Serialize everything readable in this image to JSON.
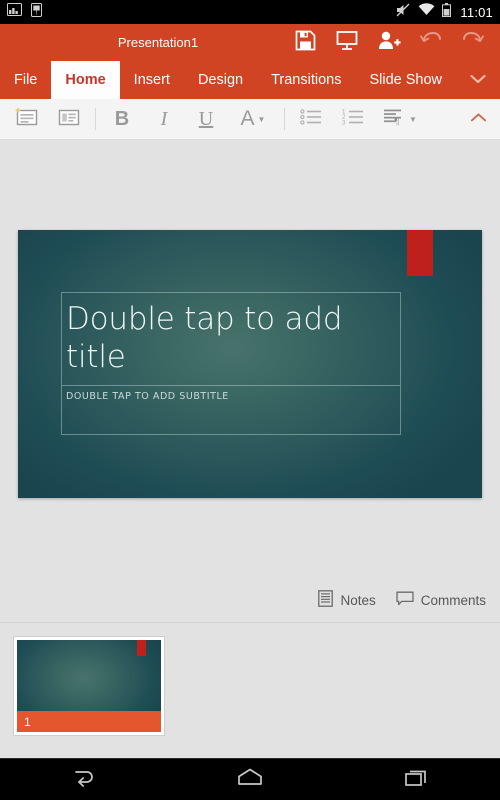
{
  "status_bar": {
    "left_icons": [
      {
        "name": "screenshot-icon"
      },
      {
        "name": "sim-card-icon"
      }
    ],
    "right_icons": [
      {
        "name": "volume-muted-icon"
      },
      {
        "name": "wifi-icon"
      },
      {
        "name": "battery-icon"
      }
    ],
    "time": "11:01"
  },
  "title_bar": {
    "document_title": "Presentation1",
    "actions": [
      {
        "name": "save-button",
        "icon": "floppy-disk-icon",
        "label": "Save",
        "enabled": true
      },
      {
        "name": "present-button",
        "icon": "projector-screen-icon",
        "label": "Present",
        "enabled": true
      },
      {
        "name": "share-button",
        "icon": "person-add-icon",
        "label": "Share",
        "enabled": true
      },
      {
        "name": "undo-button",
        "icon": "undo-arrow-icon",
        "label": "Undo",
        "enabled": false
      },
      {
        "name": "redo-button",
        "icon": "redo-arrow-icon",
        "label": "Redo",
        "enabled": false
      }
    ]
  },
  "ribbon": {
    "tabs": [
      {
        "label": "File",
        "active": false
      },
      {
        "label": "Home",
        "active": true
      },
      {
        "label": "Insert",
        "active": false
      },
      {
        "label": "Design",
        "active": false
      },
      {
        "label": "Transitions",
        "active": false
      },
      {
        "label": "Slide Show",
        "active": false
      }
    ],
    "more_tabs_icon": "chevron-down-icon",
    "collapse_icon": "chevron-up-icon",
    "tools": [
      {
        "name": "new-slide-button",
        "icon": "new-slide-icon",
        "label": "New Slide"
      },
      {
        "name": "slide-layout-button",
        "icon": "slide-layout-icon",
        "label": "Layout"
      },
      {
        "name": "bold-button",
        "icon": "bold-icon",
        "label": "B"
      },
      {
        "name": "italic-button",
        "icon": "italic-icon",
        "label": "I"
      },
      {
        "name": "underline-button",
        "icon": "underline-icon",
        "label": "U"
      },
      {
        "name": "font-color-button",
        "icon": "font-color-icon",
        "label": "A"
      },
      {
        "name": "bullet-list-button",
        "icon": "bullet-list-icon",
        "label": "Bullets"
      },
      {
        "name": "numbered-list-button",
        "icon": "numbered-list-icon",
        "label": "Numbering"
      },
      {
        "name": "paragraph-button",
        "icon": "paragraph-align-icon",
        "label": "Paragraph"
      }
    ]
  },
  "slide": {
    "title_placeholder": "Double tap to add title",
    "subtitle_placeholder": "DOUBLE TAP TO ADD SUBTITLE",
    "theme_colors": {
      "background_center": "#47736c",
      "background_edge": "#1a444e",
      "accent_rectangle": "#c0201c",
      "placeholder_border": "#bed7d4",
      "title_text": "#f2f7f6",
      "subtitle_text": "#c9dbd8"
    }
  },
  "status_strip": {
    "notes_label": "Notes",
    "notes_icon": "notes-document-icon",
    "comments_label": "Comments",
    "comments_icon": "comment-bubble-icon"
  },
  "thumbnails": [
    {
      "number": "1",
      "selected": true
    }
  ],
  "nav_bar": {
    "buttons": [
      {
        "name": "android-back-button",
        "icon": "back-arrow-icon"
      },
      {
        "name": "android-home-button",
        "icon": "home-icon"
      },
      {
        "name": "android-recents-button",
        "icon": "recent-apps-icon"
      }
    ]
  },
  "theme": {
    "brand_orange": "#d04423",
    "thumb_bar_orange": "#e4572e",
    "app_gray": "#e2e2e2",
    "toolbar_gray": "#f4f4f4"
  }
}
